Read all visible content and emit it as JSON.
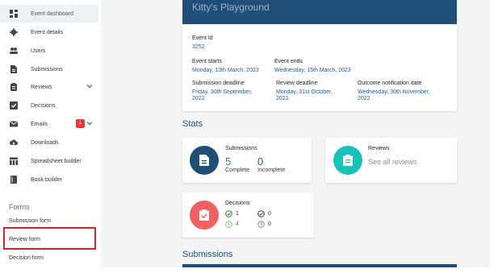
{
  "sidebar": {
    "items": [
      {
        "label": "Event dashboard",
        "icon": "dashboard-icon"
      },
      {
        "label": "Event details",
        "icon": "gear-icon"
      },
      {
        "label": "Users",
        "icon": "users-icon"
      },
      {
        "label": "Submissions",
        "icon": "document-icon"
      },
      {
        "label": "Reviews",
        "icon": "review-icon"
      },
      {
        "label": "Decisions",
        "icon": "checkbox-icon"
      },
      {
        "label": "Emails",
        "icon": "mail-icon",
        "badge": "1"
      },
      {
        "label": "Downloads",
        "icon": "cloud-download-icon"
      },
      {
        "label": "Spreadsheet builder",
        "icon": "table-icon"
      },
      {
        "label": "Book builder",
        "icon": "book-icon"
      }
    ],
    "forms_title": "Forms",
    "forms": [
      "Submission form",
      "Review form",
      "Decision form"
    ]
  },
  "hero": {
    "title": "Kitty's Playground"
  },
  "event": {
    "id_label": "Event Id",
    "id_value": "3252",
    "starts_label": "Event starts",
    "starts_value": "Monday, 13th March, 2023",
    "ends_label": "Event ends",
    "ends_value": "Wednesday, 15th March, 2023",
    "submission_label": "Submission deadline",
    "submission_value_1": "Friday, 30th September,",
    "submission_value_2": "2022",
    "review_label": "Review deadline",
    "review_value_1": "Monday, 31st October,",
    "review_value_2": "2022",
    "outcome_label": "Outcome notification date",
    "outcome_value_1": "Wednesday, 30th November,",
    "outcome_value_2": "2022"
  },
  "stats": {
    "title": "Stats",
    "submissions": {
      "title": "Submissions",
      "complete": "5",
      "complete_label": "Complete",
      "incomplete": "0",
      "incomplete_label": "Incomplete"
    },
    "reviews": {
      "title": "Reviews",
      "link": "See all reviews"
    },
    "decisions": {
      "title": "Decisions",
      "accepted": "1",
      "rejected": "0",
      "accepted_pending": "4",
      "pending": "0"
    }
  },
  "submissions_section": {
    "title": "Submissions"
  },
  "colors": {
    "navy": "#1f4e79",
    "teal": "#17c2bc",
    "coral": "#f26161",
    "green": "#2e9b3a"
  }
}
